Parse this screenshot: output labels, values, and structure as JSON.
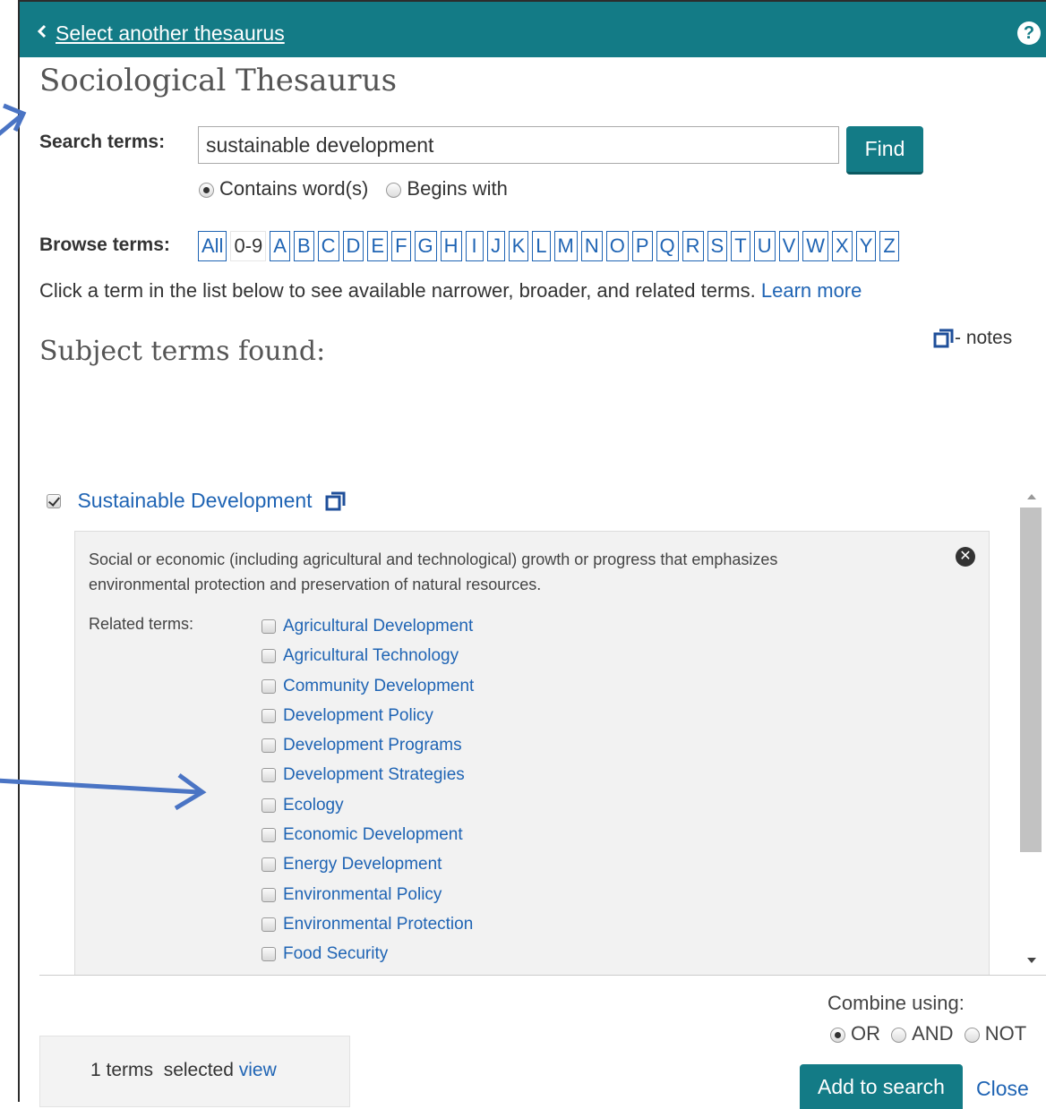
{
  "header": {
    "back_link": "Select another thesaurus",
    "help": "?"
  },
  "title": "Sociological Thesaurus",
  "search": {
    "label": "Search terms:",
    "value": "sustainable development",
    "find_label": "Find",
    "modes": [
      {
        "label": "Contains word(s)",
        "selected": true
      },
      {
        "label": "Begins with",
        "selected": false
      }
    ]
  },
  "browse": {
    "label": "Browse terms:",
    "letters": [
      "All",
      "0-9",
      "A",
      "B",
      "C",
      "D",
      "E",
      "F",
      "G",
      "H",
      "I",
      "J",
      "K",
      "L",
      "M",
      "N",
      "O",
      "P",
      "Q",
      "R",
      "S",
      "T",
      "U",
      "V",
      "W",
      "X",
      "Y",
      "Z"
    ]
  },
  "instruction": {
    "text": "Click a term in the list below to see available narrower, broader, and related terms.",
    "learn_more": "Learn more"
  },
  "subject_heading": "Subject terms found:",
  "notes_legend": "- notes",
  "main_term": {
    "label": "Sustainable Development",
    "checked": true,
    "scope_note": "Social or economic (including agricultural and technological) growth or progress that emphasizes environmental protection and preservation of natural resources.",
    "related_label": "Related terms:",
    "close_icon": "✕",
    "related": [
      "Agricultural Development",
      "Agricultural Technology",
      "Community Development",
      "Development Policy",
      "Development Programs",
      "Development Strategies",
      "Ecology",
      "Economic Development",
      "Energy Development",
      "Environmental Policy",
      "Environmental Protection",
      "Food Security"
    ]
  },
  "combine": {
    "label": "Combine using:",
    "options": [
      {
        "label": "OR",
        "selected": true
      },
      {
        "label": "AND",
        "selected": false
      },
      {
        "label": "NOT",
        "selected": false
      }
    ]
  },
  "selected": {
    "count": "1",
    "text": "terms  selected",
    "view": "view"
  },
  "actions": {
    "add_to_search": "Add to search",
    "close": "Close"
  },
  "colors": {
    "header": "#137b86",
    "link": "#1f64b4",
    "annotation_arrow": "#4a74c4"
  }
}
